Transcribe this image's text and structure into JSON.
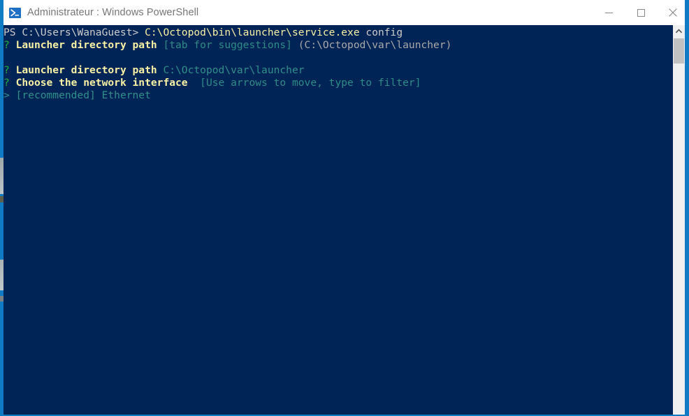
{
  "window": {
    "title": "Administrateur : Windows PowerShell",
    "icon": "powershell-icon",
    "accent_color": "#0f7bc4",
    "titlebar_background": "#ffffff",
    "title_color": "#767676",
    "controls": {
      "minimize_label": "—",
      "maximize_label": "☐",
      "close_label": "✕"
    }
  },
  "terminal": {
    "background_color": "#012456",
    "foreground_color": "#cccccc",
    "lines": [
      {
        "id": "line-command",
        "segments": [
          {
            "text": "PS C:\\Users\\WanaGuest>",
            "style": "c-white"
          },
          {
            "text": " ",
            "style": "c-white"
          },
          {
            "text": "C:\\Octopod\\bin\\launcher\\service.exe",
            "style": "c-yellow"
          },
          {
            "text": " config",
            "style": "c-white"
          }
        ]
      },
      {
        "id": "line-prompt-launcher-path",
        "segments": [
          {
            "text": "?",
            "style": "c-qmark"
          },
          {
            "text": " Launcher directory path ",
            "style": "c-yellowb"
          },
          {
            "text": "[tab for suggestions]",
            "style": "c-hint"
          },
          {
            "text": " (C:\\Octopod\\var\\launcher)",
            "style": "c-default"
          }
        ]
      },
      {
        "id": "line-blank-1",
        "segments": [
          {
            "text": "",
            "style": "c-white"
          }
        ]
      },
      {
        "id": "line-answer-launcher-path",
        "segments": [
          {
            "text": "?",
            "style": "c-qmark"
          },
          {
            "text": " Launcher directory path ",
            "style": "c-yellowb"
          },
          {
            "text": "C:\\Octopod\\var\\launcher",
            "style": "c-answer"
          }
        ]
      },
      {
        "id": "line-prompt-network-interface",
        "segments": [
          {
            "text": "?",
            "style": "c-qmark"
          },
          {
            "text": " Choose the network interface ",
            "style": "c-yellowb"
          },
          {
            "text": " [Use arrows to move, type to filter]",
            "style": "c-hint"
          }
        ]
      },
      {
        "id": "line-choice-ethernet",
        "segments": [
          {
            "text": ">",
            "style": "c-choice"
          },
          {
            "text": " [recommended] Ethernet",
            "style": "c-choice"
          }
        ]
      }
    ]
  },
  "scrollbar": {
    "up_arrow": "chevron-up-icon",
    "track_color": "#f0f0f0",
    "thumb_color": "#c1c1c1"
  }
}
